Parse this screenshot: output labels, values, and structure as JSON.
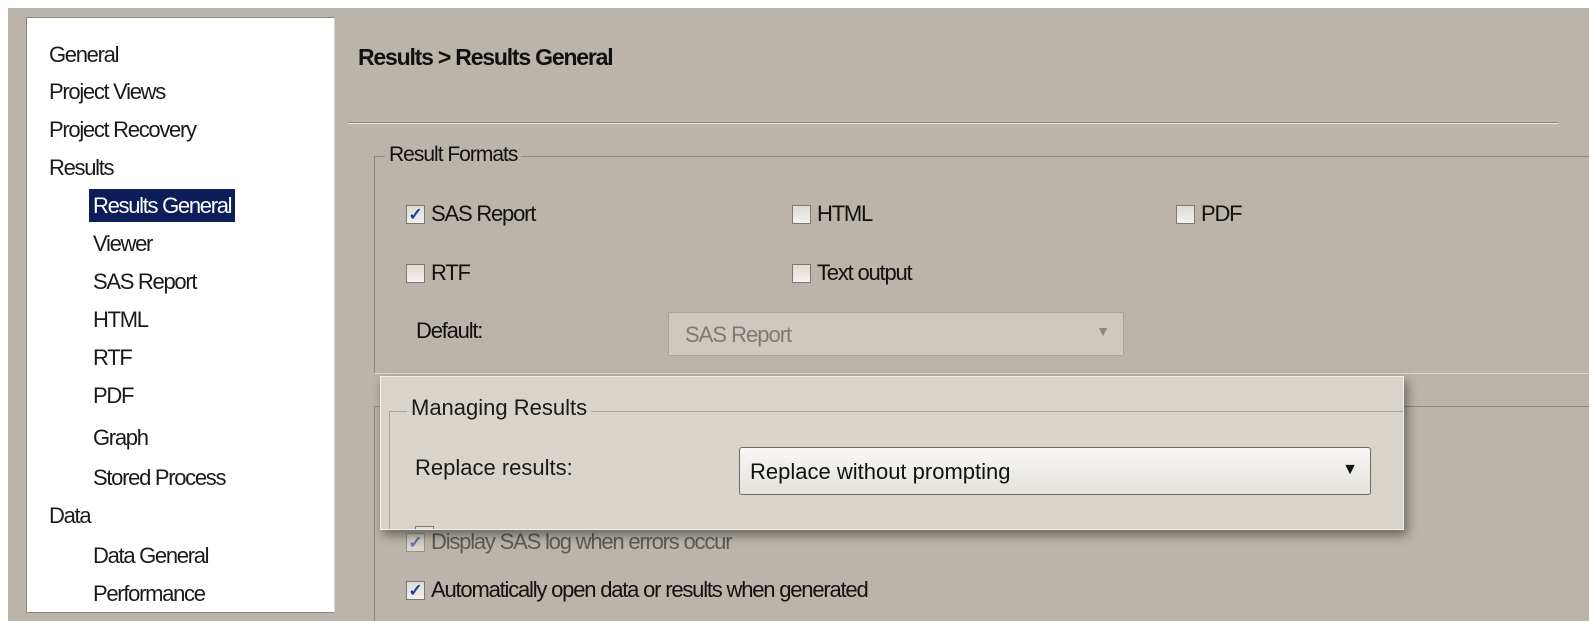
{
  "nav": {
    "items": [
      {
        "label": "General",
        "level": 0,
        "selected": false
      },
      {
        "label": "Project Views",
        "level": 0,
        "selected": false
      },
      {
        "label": "Project Recovery",
        "level": 0,
        "selected": false
      },
      {
        "label": "Results",
        "level": 0,
        "selected": false
      },
      {
        "label": "Results General",
        "level": 1,
        "selected": true
      },
      {
        "label": "Viewer",
        "level": 1,
        "selected": false
      },
      {
        "label": "SAS Report",
        "level": 1,
        "selected": false
      },
      {
        "label": "HTML",
        "level": 1,
        "selected": false
      },
      {
        "label": "RTF",
        "level": 1,
        "selected": false
      },
      {
        "label": "PDF",
        "level": 1,
        "selected": false
      },
      {
        "label": "Graph",
        "level": 1,
        "selected": false
      },
      {
        "label": "Stored Process",
        "level": 1,
        "selected": false
      },
      {
        "label": "Data",
        "level": 0,
        "selected": false
      },
      {
        "label": "Data General",
        "level": 1,
        "selected": false
      },
      {
        "label": "Performance",
        "level": 1,
        "selected": false
      }
    ]
  },
  "page": {
    "title": "Results > Results General"
  },
  "result_formats": {
    "legend": "Result Formats",
    "options": [
      {
        "label": "SAS Report",
        "checked": true
      },
      {
        "label": "HTML",
        "checked": false
      },
      {
        "label": "PDF",
        "checked": false
      },
      {
        "label": "RTF",
        "checked": false
      },
      {
        "label": "Text output",
        "checked": false
      }
    ],
    "default_label": "Default:",
    "default_value": "SAS Report"
  },
  "managing_results": {
    "legend": "Managing Results",
    "replace_label": "Replace results:",
    "replace_value": "Replace without prompting",
    "options": [
      {
        "label": "Display SAS log when errors occur",
        "checked": true
      },
      {
        "label": "Automatically open data or results when generated",
        "checked": true
      }
    ]
  },
  "colors": {
    "dialog_bg": "#bab4aa",
    "selection": "#0d1d5a",
    "check_mark": "#233ea6"
  }
}
